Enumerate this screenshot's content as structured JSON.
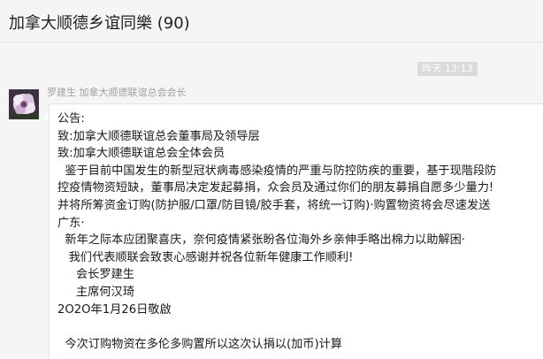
{
  "chat": {
    "title": "加拿大顺德乡谊同樂 (90)"
  },
  "timestamp": "昨天 13:13",
  "message": {
    "sender": "罗建生 加拿大顺德联谊总会会长",
    "lines": [
      "公告:",
      "致:加拿大顺德联谊总会董事局及领导层",
      "致:加拿大顺德联谊总会全体会员",
      "  鉴于目前中国发生的新型冠状病毒感染疫情的严重与防控防疾的重要，基于现階段防",
      "控疫情物资短缺，董事局决定发起募捐，众会员及通过你们的朋友募捐自愿多少量力!",
      "并将所筹资金订购(防护服/口罩/防目镜/胶手套，将统一订购)·购置物资将会尽速发送",
      "广东·",
      "  新年之际本应团聚喜庆，奈何疫情紧张盼各位海外乡亲伸手略出棉力以助解困·",
      "   我们代表顺联会致衷心感谢并祝各位新年健康工作顺利!",
      "     会长罗建生",
      "     主席何汉琦",
      "2O2O年1月26日敬啟",
      "",
      "  今次订购物资在多伦多购置所以这次认捐以(加币)计算"
    ]
  }
}
